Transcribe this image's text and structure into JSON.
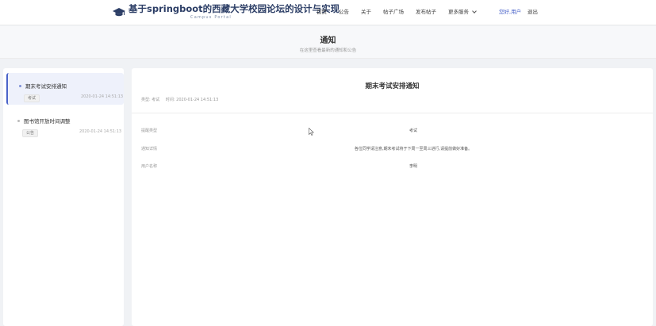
{
  "nav": {
    "brand_title": "基于springboot的西藏大学校园论坛的设计与实现",
    "brand_sub": "Campus Portal",
    "links": [
      "首页",
      "公告",
      "关于",
      "帖子广场",
      "发布帖子"
    ],
    "more_label": "更多服务",
    "user_label": "您好,用户",
    "logout_label": "退出"
  },
  "header": {
    "title": "通知",
    "subtitle": "在这里查看最新的通知和公告"
  },
  "sidebar": {
    "items": [
      {
        "title": "期末考试安排通知",
        "badge": "考试",
        "time": "2020-01-24 14:51:13"
      },
      {
        "title": "图书馆开放时间调整",
        "badge": "公告",
        "time": "2020-01-24 14:51:13"
      }
    ]
  },
  "detail": {
    "title": "期末考试安排通知",
    "meta_type": "类型: 考试",
    "meta_time": "时间: 2020-01-24 14:51:13",
    "rows": [
      {
        "label": "提醒类型",
        "value": "考试"
      },
      {
        "label": "通知详情",
        "value": "各位同学请注意,期末考试将于下周一至周三进行,请提前做好准备。"
      },
      {
        "label": "用户名称",
        "value": "李明"
      }
    ]
  },
  "colors": {
    "brand": "#2c3e66",
    "accent": "#4a63c9",
    "background": "#f0f2f5",
    "active_item_bg": "#eef1fb"
  },
  "icons": {
    "brand": "graduation-cap-icon",
    "more": "chevron-down-icon",
    "cursor": "mouse-pointer-icon"
  }
}
